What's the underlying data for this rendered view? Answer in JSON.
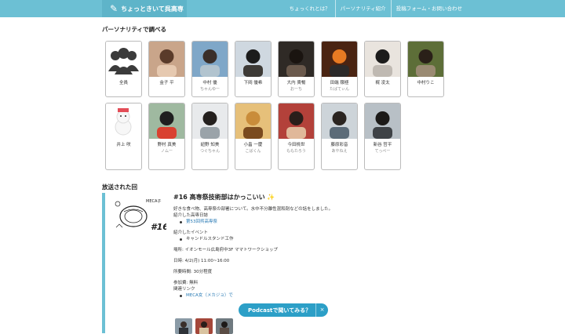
{
  "header": {
    "site_title": "ちょっときいて呉高専",
    "nav": [
      "ちょっくれとは？",
      "パーソナリティ紹介",
      "投稿フォーム・お問い合わせ"
    ]
  },
  "personality_section": {
    "heading": "パーソナリティで調べる",
    "cards": [
      {
        "name": "全員",
        "nick": ""
      },
      {
        "name": "金子 平",
        "nick": ""
      },
      {
        "name": "中村 優",
        "nick": "ちゃんゆー"
      },
      {
        "name": "下岡 優希",
        "nick": ""
      },
      {
        "name": "大内 貴暢",
        "nick": "おーち"
      },
      {
        "name": "田端 穣極",
        "nick": "たばてぃん"
      },
      {
        "name": "梶 凌太",
        "nick": ""
      },
      {
        "name": "中村りこ",
        "nick": ""
      },
      {
        "name": "井上 咲",
        "nick": ""
      },
      {
        "name": "野村 真美",
        "nick": "ノムー"
      },
      {
        "name": "紐野 知美",
        "nick": "つぐちゃん"
      },
      {
        "name": "小畠 一慶",
        "nick": "こばくん"
      },
      {
        "name": "今田桃世",
        "nick": "ももたろう"
      },
      {
        "name": "藤原彩音",
        "nick": "あやねえ"
      },
      {
        "name": "新谷 哲平",
        "nick": "てっぺー"
      }
    ]
  },
  "episodes_section": {
    "heading": "放送された回",
    "episode": {
      "title": "#16 高専祭技術部はかっこいい",
      "art_text": "#16",
      "art_brand": "MECA子",
      "description": "好きな食べ物、高専祭の部署について。水中不分離性混和剤などの話をしました。",
      "intro_school_label": "紹介した高専日誌",
      "intro_school_link": "第53回呉高専祭",
      "intro_event_label": "紹介したイベント",
      "intro_event_item": "キャンドルスタンド工作",
      "place": "場所: イオンモール広島府中3F ママトワークショップ",
      "date": "日時: 4/2(月) 11:00~16:00",
      "duration": "所要時間: 30分程度",
      "fee": "参加費: 無料",
      "related_label": "関連リンク",
      "related_link": "MECA女（メカジョ）で"
    }
  },
  "podcast_button": {
    "label": "Podcastで聞いてみる？",
    "close": "×"
  },
  "colors": {
    "header": "#6cc0d4",
    "accent": "#2c9fc7",
    "link": "#2a7bb5"
  }
}
